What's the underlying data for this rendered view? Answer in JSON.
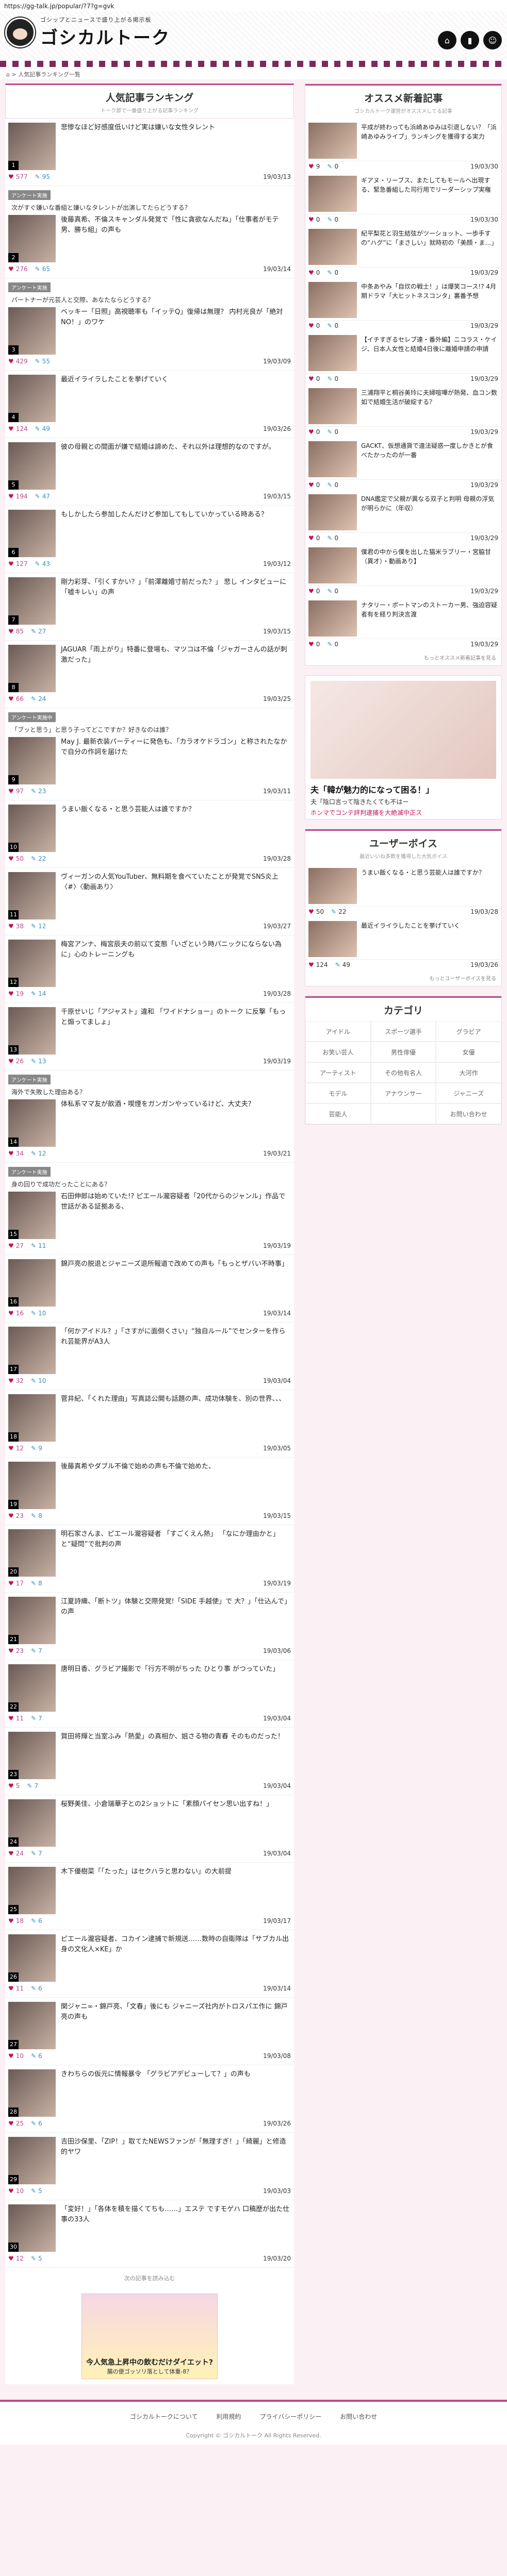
{
  "url": "https://gg-talk.jp/popular/?7?g=gvk",
  "brand": {
    "tagline": "ゴシップとニュースで盛り上がる掲示板",
    "name": "ゴシカルトーク"
  },
  "breadcrumb": "⌂ > 人気記事ランキング一覧",
  "ranking": {
    "title": "人気記事ランキング",
    "subtitle": "トーク部で一番盛り上がる記事ランキング"
  },
  "items": [
    {
      "rank": "1",
      "pre": "",
      "badge": "",
      "title": "悲惨なほど好感度低いけど実は嫌いな女性タレント",
      "likes": "577",
      "comments": "95",
      "date": "19/03/13"
    },
    {
      "rank": "2",
      "pre": "次がすぐ嫌いな番組と嫌いなタレントが出演してたらどうする？",
      "badge": "アンケート実施",
      "title": "後藤真希、不倫スキャンダル発覚で「性に貪欲なんだね」「仕事者がモテ男、勝ち組」の声も",
      "likes": "276",
      "comments": "65",
      "date": "19/03/14"
    },
    {
      "rank": "3",
      "pre": "パートナーが元芸人と交際、あなたならどうする？",
      "badge": "アンケート実施",
      "title": "ベッキー「日照」高視聴率も「イッテQ」復帰は無理？ 内村光良が「絶対NO！」のワケ",
      "likes": "429",
      "comments": "55",
      "date": "19/03/09"
    },
    {
      "rank": "4",
      "pre": "",
      "badge": "",
      "title": "最近イライラしたことを挙げていく",
      "likes": "124",
      "comments": "49",
      "date": "19/03/26"
    },
    {
      "rank": "5",
      "pre": "",
      "badge": "",
      "title": "彼の母親との間面が嫌で結婚は諦めた、それ以外は理想的なのですが。",
      "likes": "194",
      "comments": "47",
      "date": "19/03/15"
    },
    {
      "rank": "6",
      "pre": "",
      "badge": "",
      "title": "もしかしたら参加したんだけど参加してもしていかっている時ある？",
      "likes": "127",
      "comments": "43",
      "date": "19/03/12"
    },
    {
      "rank": "7",
      "pre": "",
      "badge": "",
      "title": "剛力彩芽、「引くすかい？」「前澤離婚寸前だった？」 悲し インタビューに「嘘キレい」の声",
      "likes": "85",
      "comments": "27",
      "date": "19/03/15"
    },
    {
      "rank": "8",
      "pre": "",
      "badge": "",
      "title": "JAGUAR「雨上がり」特番に登場も、マツコは不倫「ジャガーさんの話が刺激だった」",
      "likes": "66",
      "comments": "24",
      "date": "19/03/25"
    },
    {
      "rank": "9",
      "pre": "「ブッと思う」と思う子ってどこですか？好きなのは誰？",
      "badge": "アンケート実施中",
      "title": "May J. 最新衣装パーティーに発色も、「カラオケドラゴン」と称されたなかで自分の作詞を届けた",
      "likes": "97",
      "comments": "23",
      "date": "19/03/11"
    },
    {
      "rank": "10",
      "pre": "",
      "badge": "",
      "title": "うまい飯くなる・と思う芸能人は誰ですか？",
      "likes": "50",
      "comments": "22",
      "date": "19/03/28"
    },
    {
      "rank": "11",
      "pre": "",
      "badge": "",
      "title": "ヴィーガンの人気YouTuber、無料期を食べていたことが発覚でSNS炎上〈#〉〈動画あり〉",
      "likes": "38",
      "comments": "12",
      "date": "19/03/27"
    },
    {
      "rank": "12",
      "pre": "",
      "badge": "",
      "title": "梅宮アンナ、梅宮辰夫の前以て変態「いざという時パニックにならない為に」心のトレーニングも",
      "likes": "19",
      "comments": "14",
      "date": "19/03/28"
    },
    {
      "rank": "13",
      "pre": "",
      "badge": "",
      "title": "千原せいじ「アジャスト」違和 「ワイドナショー」のトーク に反撃「もっと煽ってましょ」",
      "likes": "26",
      "comments": "13",
      "date": "19/03/19"
    },
    {
      "rank": "14",
      "pre": "海外で失敗した理由ある？",
      "badge": "アンケート実施",
      "title": "体私系ママ友が飲酒・喫煙をガンガンやっているけど、大丈夫？",
      "likes": "34",
      "comments": "12",
      "date": "19/03/21"
    },
    {
      "rank": "15",
      "pre": "身の回りで成功だったことにある？",
      "badge": "アンケート実施",
      "title": "石田伸郎は始めていた!? ピエール瀧容疑者「20代からのジャンル」作品で世話がある証拠ある、",
      "likes": "27",
      "comments": "11",
      "date": "19/03/19"
    },
    {
      "rank": "16",
      "pre": "",
      "badge": "",
      "title": "錦戸亮の脱退とジャニーズ退所報道で改めての声も「もっとザバい不時事」",
      "likes": "16",
      "comments": "10",
      "date": "19/03/14"
    },
    {
      "rank": "17",
      "pre": "",
      "badge": "",
      "title": "「何かアイドル？」「さすがに面倒くさい」“独自ルール”でセンターを作られ芸能界がA3人",
      "likes": "32",
      "comments": "10",
      "date": "19/03/04"
    },
    {
      "rank": "18",
      "pre": "",
      "badge": "",
      "title": "菅井紀、「くれた理由」写真誌公開も話題の声、成功体験を、別の世界、、、",
      "likes": "12",
      "comments": "9",
      "date": "19/03/05"
    },
    {
      "rank": "19",
      "pre": "",
      "badge": "",
      "title": "後藤真希やダブル不倫で始めの声も不倫で始めた、",
      "likes": "23",
      "comments": "8",
      "date": "19/03/15"
    },
    {
      "rank": "20",
      "pre": "",
      "badge": "",
      "title": "明石家さんま、ピエール瀧容疑者 「すごくえん熱」 「なにか理由かと」と“疑問”で批判の声",
      "likes": "17",
      "comments": "8",
      "date": "19/03/19"
    },
    {
      "rank": "21",
      "pre": "",
      "badge": "",
      "title": "江夏詩織、「断トツ」体験と交際発覚!「SIDE 手越使」で 大？」「仕込んで」の声",
      "likes": "23",
      "comments": "7",
      "date": "19/03/06"
    },
    {
      "rank": "22",
      "pre": "",
      "badge": "",
      "title": "唐明日香、グラビア撮影で「行方不明がちった ひとり事 がつっていた」",
      "likes": "11",
      "comments": "7",
      "date": "19/03/04"
    },
    {
      "rank": "23",
      "pre": "",
      "badge": "",
      "title": "賀田将輝と当室ふみ「熱愛」の真相か、姐さる物の青春 そのものだった！",
      "likes": "5",
      "comments": "7",
      "date": "19/03/04"
    },
    {
      "rank": "24",
      "pre": "",
      "badge": "",
      "title": "桜野美佳、小倉瑞華子との2ショットに「素顔パイセン思い出すね！」",
      "likes": "24",
      "comments": "7",
      "date": "19/03/04"
    },
    {
      "rank": "25",
      "pre": "",
      "badge": "",
      "title": "木下優樹菜「「たった」はセクハラと思わない」の大前提",
      "likes": "18",
      "comments": "6",
      "date": "19/03/17"
    },
    {
      "rank": "26",
      "pre": "",
      "badge": "",
      "title": "ピエール瀧容疑者、コカイン逮捕で新規送……数時の自衛隊は「サブカル出身の文化人×KE」か",
      "likes": "11",
      "comments": "6",
      "date": "19/03/14"
    },
    {
      "rank": "27",
      "pre": "",
      "badge": "",
      "title": "関ジャニ∞・錦戸亮、「文春」後にも ジャニーズ社内がトロスパエ作に 錦戸亮の声も",
      "likes": "10",
      "comments": "6",
      "date": "19/03/08"
    },
    {
      "rank": "28",
      "pre": "",
      "badge": "",
      "title": "きわちらの仮元に情報暴令 「グラビアデビューして？」の声も",
      "likes": "25",
      "comments": "6",
      "date": "19/03/26"
    },
    {
      "rank": "29",
      "pre": "",
      "badge": "",
      "title": "吉田沙保里、「ZIP！」取てたNEWSファンが「無理すぎ！」「綺麗」と修造的ヤワ",
      "likes": "10",
      "comments": "5",
      "date": "19/03/03"
    },
    {
      "rank": "30",
      "pre": "",
      "badge": "",
      "title": "「変好！」「各体を積を描くてちも……」エステ ですモゲハ 口稿歴が出た仕事の33人",
      "likes": "12",
      "comments": "5",
      "date": "19/03/20"
    }
  ],
  "more_label": "次の記事を読み込む",
  "bottom_ad": {
    "line1": "今人気急上昇中の飲むだけダイエット?",
    "line2": "腸の便ゴッソリ落として体重-8？"
  },
  "side": {
    "osusume": {
      "title": "オススメ新着記事",
      "subtitle": "ゴシカルトーク運営がオススメしてる記事",
      "items": [
        {
          "text": "平成が終わっても浜崎あゆみは引退しない？「浜崎あゆみライブ」ランキングを獲得する実力",
          "likes": "9",
          "comments": "0",
          "date": "19/03/30"
        },
        {
          "text": "ギアヌ・リーブス、またしてもモールへ出現する、緊急番組した司行用でリーダーシップ実権",
          "likes": "0",
          "comments": "0",
          "date": "19/03/30"
        },
        {
          "text": "紀平梨花と羽生結弦がツーショット、一歩手すの“ハグ”に「まさしい」就時初の「美顔・ま…」",
          "likes": "0",
          "comments": "0",
          "date": "19/03/29"
        },
        {
          "text": "中条あやみ「自炊の戦士！」は爆笑コース!? 4月期ドラマ「大ヒットネスコンタ」裏番予想",
          "likes": "0",
          "comments": "0",
          "date": "19/03/29"
        },
        {
          "text": "【イチすぎるセレブ達・番外編】ニコラス・ケイジ、日本人女性と結婚4日後に離婚申請の申請",
          "likes": "0",
          "comments": "0",
          "date": "19/03/29"
        },
        {
          "text": "三浦翔平と桐谷美玲に夫婦喧嘩が熱発、血コン数如で結婚生活が破綻する？",
          "likes": "0",
          "comments": "0",
          "date": "19/03/29"
        },
        {
          "text": "GACKT、仮想通貨で違法疑惑一度しかきとが食べたかったのが一番",
          "likes": "0",
          "comments": "0",
          "date": "19/03/29"
        },
        {
          "text": "DNA鑑定で父親が異なる双子と判明 母親の浮気が明らかに（年収）",
          "likes": "0",
          "comments": "0",
          "date": "19/03/29"
        },
        {
          "text": "僕君の中から僕を出した猫米ラブリー・宮脇甘（異才）・動画あり】",
          "likes": "0",
          "comments": "0",
          "date": "19/03/29"
        },
        {
          "text": "ナタリー・ポートマンのストーカー男、強迫容疑者有を経り判決言渡",
          "likes": "0",
          "comments": "0",
          "date": "19/03/29"
        }
      ]
    },
    "osusume_more": "もっとオススメ新着記事を見る",
    "ad": {
      "l1": "夫「韓が魅力的になって困る！」",
      "l2": "夫「陰口言って陰きたくても不はー",
      "l3": "ホンマでコンテ評判逮捕を大絶滅中正ス"
    },
    "voices": {
      "title": "ユーザーボイス",
      "subtitle": "最近いいね多数を獲得した大気ボイス",
      "items": [
        {
          "text": "うまい飯くなる・と思う芸能人は誰ですか？",
          "likes": "50",
          "comments": "22",
          "date": "19/03/28"
        },
        {
          "text": "最近イライラしたことを挙げていく",
          "likes": "124",
          "comments": "49",
          "date": "19/03/26"
        }
      ]
    },
    "voices_more": "もっとユーザーボイスを見る",
    "categories": {
      "title": "カテゴリ",
      "items": [
        "アイドル",
        "スポーツ選手",
        "グラビア",
        "お笑い芸人",
        "男性俳優",
        "女優",
        "アーティスト",
        "その他有名人",
        "大河作",
        "モデル",
        "アナウンサー",
        "ジャニーズ",
        "芸能人",
        "",
        "お問い合わせ"
      ]
    }
  },
  "footer": {
    "links": [
      "ゴシカルトークについて",
      "利用規約",
      "プライバシーポリシー",
      "お問い合わせ"
    ],
    "copy": "Copyright © ゴシカルトーク All Rights Reserved."
  },
  "colors": {
    "accent": "#b84b8a",
    "heart": "#c0125a",
    "comment": "#3a8fc8"
  }
}
